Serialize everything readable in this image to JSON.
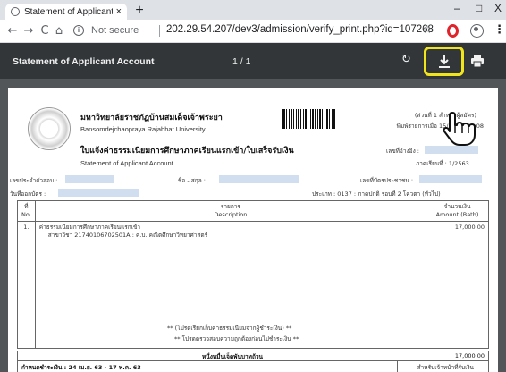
{
  "browser": {
    "tab_title": "Statement of Applicant Account",
    "tab_close": "×",
    "new_tab": "+",
    "minimize": "–",
    "restore": "□",
    "close": "X",
    "nav": {
      "back": "←",
      "forward": "→",
      "reload": "C",
      "home": "⌂"
    },
    "security_label": "Not secure",
    "info_glyph": "i",
    "url": "202.29.54.207/dev3/admission/verify_print.php?id=107268",
    "star_glyph": "☆",
    "menu_glyph": "⋮",
    "icons": [
      "info-icon",
      "star-icon",
      "opera-icon",
      "account-icon",
      "menu-icon"
    ]
  },
  "pdf_toolbar": {
    "title": "Statement of Applicant Account",
    "page_indicator": "1 / 1",
    "rotate_glyph": "↻",
    "highlight_color": "#f0e51c",
    "icons": [
      "rotate-icon",
      "download-icon",
      "print-icon"
    ]
  },
  "document": {
    "university_th": "มหาวิทยาลัยราชภัฏบ้านสมเด็จเจ้าพระยา",
    "university_en": "Bansomdejchaopraya Rajabhat University",
    "copy_label": "(ส่วนที่ 1 สำหรับผู้สมัคร)",
    "printed_at": "พิมพ์รายการเมื่อ 15/04/63 14:08",
    "title_th": "ใบแจ้งค่าธรรมเนียมการศึกษาภาคเรียนแรกเข้า/ใบเสร็จรับเงิน",
    "title_en": "Statement of Applicant Account",
    "ref_label": "เลขที่อ้างอิง :",
    "term_label": "ภาคเรียนที่ : 1/2563",
    "applicant_id_label": "เลขประจำตัวสอบ :",
    "name_label": "ชื่อ - สกุล :",
    "citizen_id_label": "เลขที่บัตรประชาชน :",
    "issue_date_label": "วันที่ออกบัตร :",
    "type_label": "ประเภท : 0137 : ภาคปกติ รอบที่ 2 โควตา (ทั่วไป)",
    "table": {
      "col_no_th": "ที่",
      "col_no_en": "No.",
      "col_desc_th": "รายการ",
      "col_desc_en": "Description",
      "col_amt_th": "จำนวนเงิน",
      "col_amt_en": "Amount (Bath)",
      "rows": [
        {
          "no": "1.",
          "line1": "ค่าธรรมเนียมการศึกษาภาคเรียนแรกเข้า",
          "line2": "สาขาวิชา 21740106702501A : ค.บ. คณิตศึกษาวิทยาศาสตร์",
          "amount": "17,000.00"
        }
      ]
    },
    "note1": "** (โปรดเรียกเก็บค่าธรรมเนียมจากผู้ชำระเงิน) **",
    "note2": "** โปรดตรวจสอบความถูกต้องก่อนไปชำระเงิน **",
    "total_text": "หนึ่งหมื่นเจ็ดพันบาทถ้วน",
    "total_amount": "17,000.00",
    "due_label": "กำหนดชำระเงิน : 24 เม.ย. 63 - 17 พ.ค. 63",
    "bank_label": "สำหรับเจ้าหน้าที่รับเงิน"
  }
}
